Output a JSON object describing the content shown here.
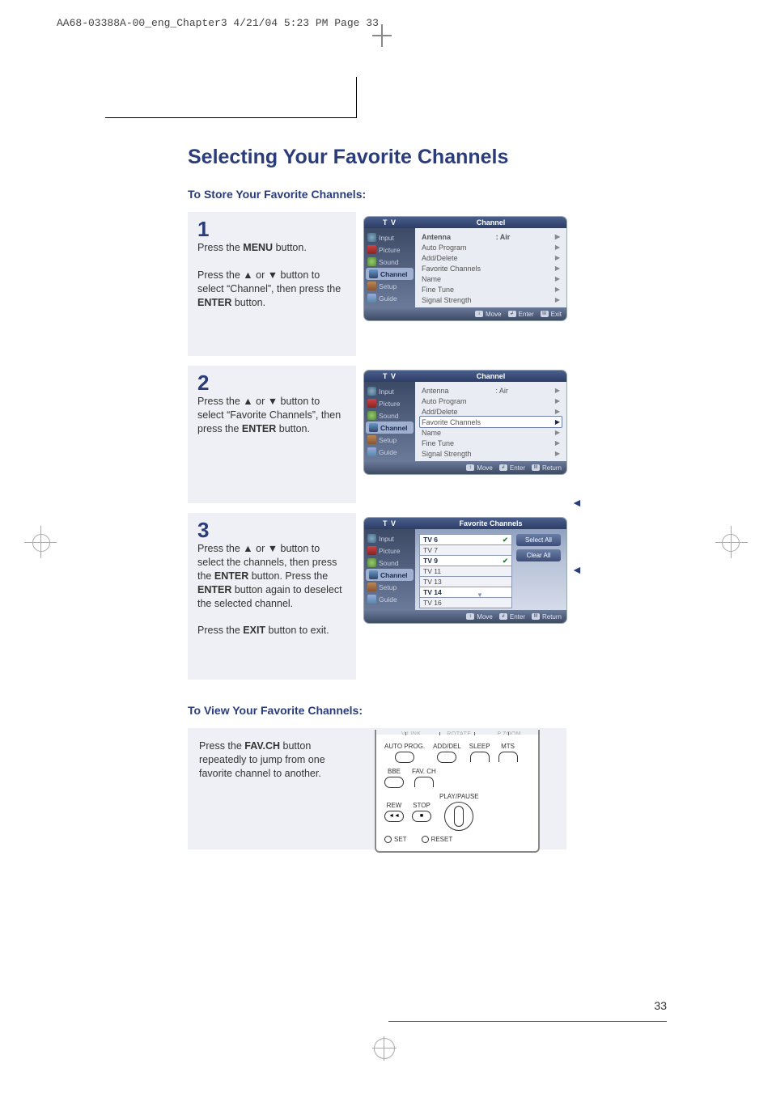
{
  "header": "AA68-03388A-00_eng_Chapter3  4/21/04  5:23 PM  Page 33",
  "title": "Selecting Your Favorite Channels",
  "subhead_store": "To Store Your Favorite Channels:",
  "subhead_view": "To View Your Favorite Channels:",
  "page_number": "33",
  "steps": {
    "s1": {
      "num": "1",
      "p1a": "Press the ",
      "p1b": "MENU",
      "p1c": " button.",
      "p2a": "Press the ▲ or ▼ button to select “Channel”, then press the ",
      "p2b": "ENTER",
      "p2c": " button."
    },
    "s2": {
      "num": "2",
      "p1a": "Press the ▲ or ▼ button to select “Favorite Channels”, then press the ",
      "p1b": "ENTER",
      "p1c": " button."
    },
    "s3": {
      "num": "3",
      "p1a": "Press the ▲ or ▼ button to select the channels, then press the ",
      "p1b": "ENTER",
      "p1c": " button. Press the ",
      "p1d": "ENTER",
      "p1e": " button again to deselect the selected channel.",
      "p2a": "Press the ",
      "p2b": "EXIT",
      "p2c": " button to exit."
    }
  },
  "view": {
    "p1a": "Press the ",
    "p1b": "FAV.CH",
    "p1c": " button repeatedly to jump from one favorite channel to another."
  },
  "remote_top": {
    "a": "V.LINK",
    "b": "ROTATE",
    "c": "P.ZOOM"
  },
  "remote": {
    "r1": [
      "AUTO PROG.",
      "ADD/DEL",
      "SLEEP",
      "MTS"
    ],
    "r2": [
      "BBE",
      "FAV. CH"
    ],
    "r3": [
      "REW",
      "STOP",
      "PLAY/PAUSE"
    ],
    "r4": [
      "SET",
      "RESET"
    ],
    "rew_sym": "◄◄",
    "stop_sym": "■"
  },
  "tv_side": [
    "Input",
    "Picture",
    "Sound",
    "Channel",
    "Setup",
    "Guide"
  ],
  "tv_title_brand": "T V",
  "tv1": {
    "title": "Channel",
    "rows": [
      {
        "label": "Antenna",
        "val": ": Air"
      },
      {
        "label": "Auto Program",
        "val": ""
      },
      {
        "label": "Add/Delete",
        "val": ""
      },
      {
        "label": "Favorite Channels",
        "val": ""
      },
      {
        "label": "Name",
        "val": ""
      },
      {
        "label": "Fine Tune",
        "val": ""
      },
      {
        "label": "Signal Strength",
        "val": ""
      }
    ],
    "foot": [
      "Move",
      "Enter",
      "Exit"
    ]
  },
  "tv2": {
    "title": "Channel",
    "rows": [
      {
        "label": "Antenna",
        "val": ": Air"
      },
      {
        "label": "Auto Program",
        "val": ""
      },
      {
        "label": "Add/Delete",
        "val": ""
      },
      {
        "label": "Favorite Channels",
        "val": "",
        "hl": true
      },
      {
        "label": "Name",
        "val": ""
      },
      {
        "label": "Fine Tune",
        "val": ""
      },
      {
        "label": "Signal Strength",
        "val": ""
      }
    ],
    "foot": [
      "Move",
      "Enter",
      "Return"
    ]
  },
  "tv3": {
    "title": "Favorite Channels",
    "list": [
      {
        "label": "TV 6",
        "chk": true,
        "hl": true
      },
      {
        "label": "TV 7"
      },
      {
        "label": "TV 9",
        "chk": true,
        "hl": true
      },
      {
        "label": "TV 11"
      },
      {
        "label": "TV 13"
      },
      {
        "label": "TV 14",
        "hl": true
      },
      {
        "label": "TV 16"
      }
    ],
    "btns": [
      "Select All",
      "Clear All"
    ],
    "scroll": "▼",
    "foot": [
      "Move",
      "Enter",
      "Return"
    ]
  },
  "foot_icons": {
    "move": "↕",
    "enter": "↲",
    "menu": "III"
  }
}
